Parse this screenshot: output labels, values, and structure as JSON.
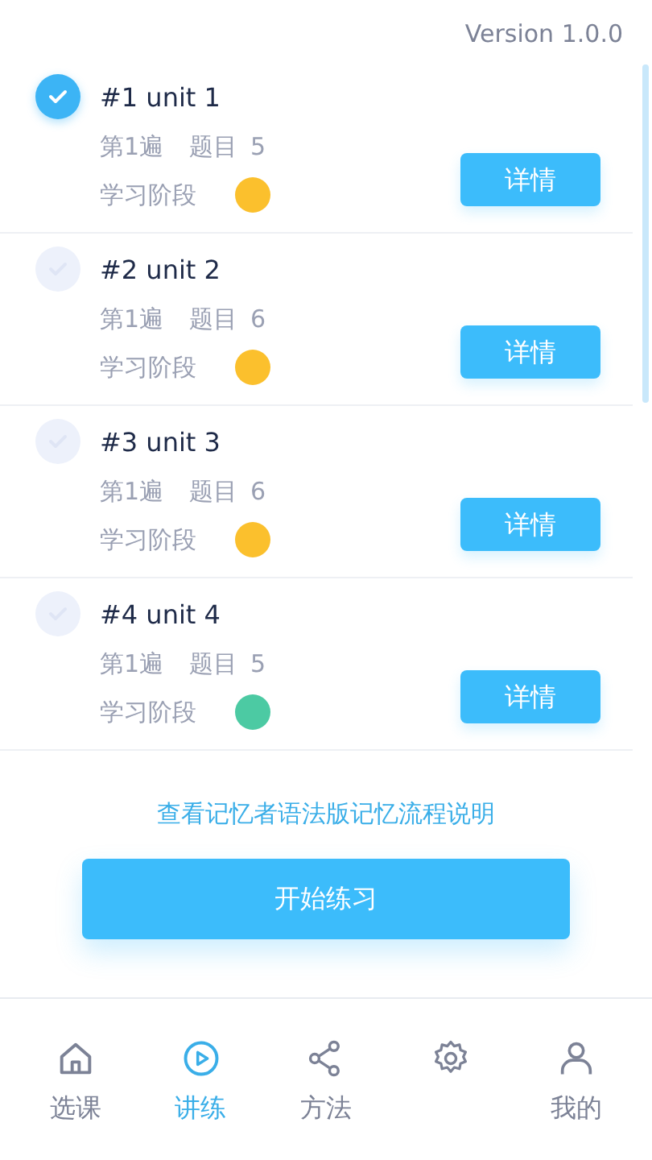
{
  "version": "Version 1.0.0",
  "units": [
    {
      "title": "#1 unit 1",
      "pass": "第1遍",
      "count_label": "题目",
      "count": "5",
      "stage_label": "学习阶段",
      "color": "#fbc02d",
      "checked": true,
      "button": "详情"
    },
    {
      "title": "#2 unit 2",
      "pass": "第1遍",
      "count_label": "题目",
      "count": "6",
      "stage_label": "学习阶段",
      "color": "#fbc02d",
      "checked": false,
      "button": "详情"
    },
    {
      "title": "#3 unit 3",
      "pass": "第1遍",
      "count_label": "题目",
      "count": "6",
      "stage_label": "学习阶段",
      "color": "#fbc02d",
      "checked": false,
      "button": "详情"
    },
    {
      "title": "#4 unit 4",
      "pass": "第1遍",
      "count_label": "题目",
      "count": "5",
      "stage_label": "学习阶段",
      "color": "#4ccaa3",
      "checked": false,
      "button": "详情"
    }
  ],
  "info_link": "查看记忆者语法版记忆流程说明",
  "start_button": "开始练习",
  "tabs": [
    {
      "label": "选课",
      "selected": false
    },
    {
      "label": "讲练",
      "selected": true
    },
    {
      "label": "方法",
      "selected": false
    },
    {
      "selected": false
    },
    {
      "label": "我的",
      "selected": false
    }
  ]
}
